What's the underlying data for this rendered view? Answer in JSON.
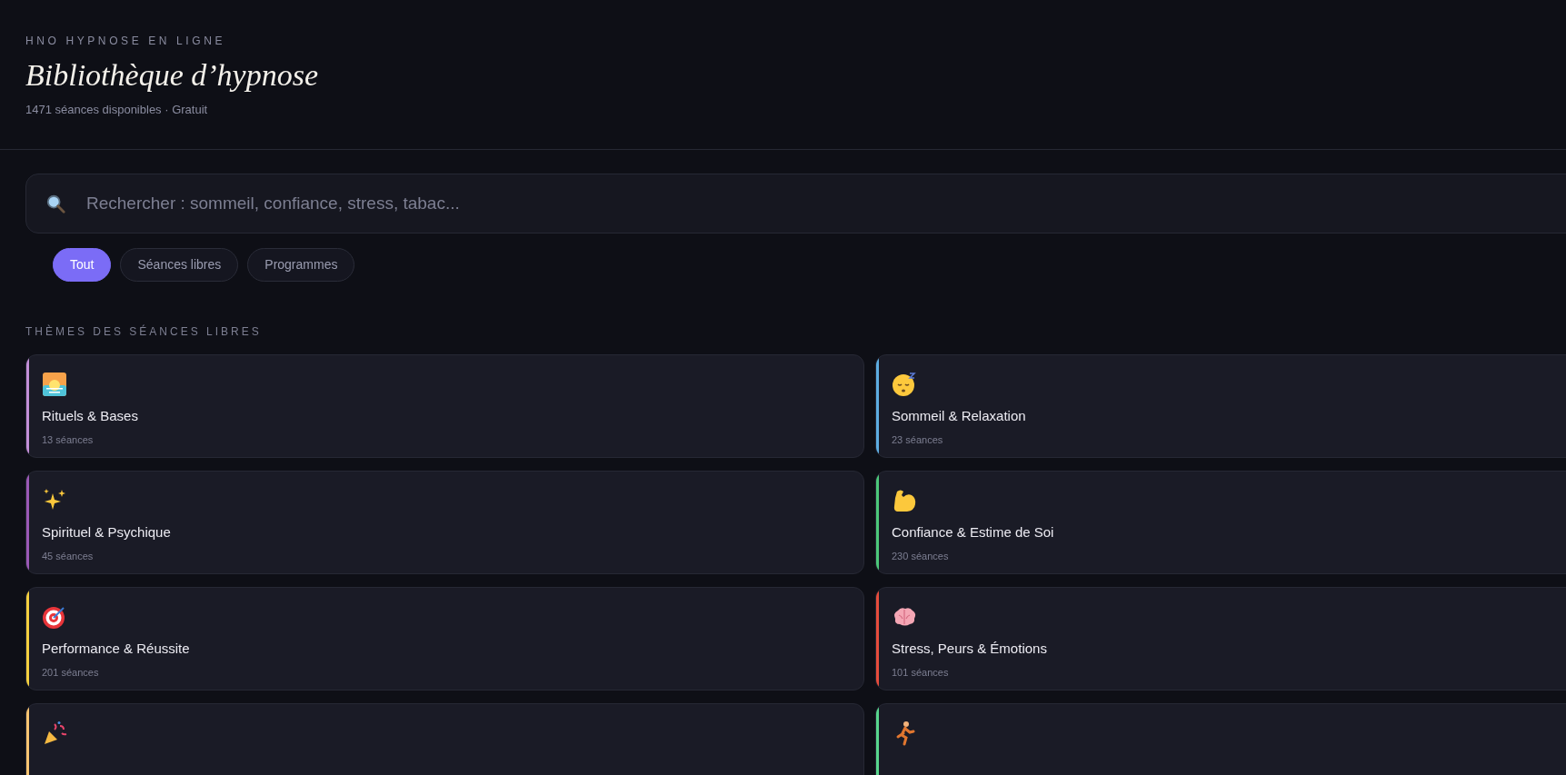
{
  "header": {
    "eyebrow": "HNO HYPNOSE EN LIGNE",
    "title": "Bibliothèque d’hypnose",
    "subtitle": "1471 séances disponibles · Gratuit"
  },
  "search": {
    "placeholder": "Rechercher : sommeil, confiance, stress, tabac..."
  },
  "filters": [
    {
      "label": "Tout",
      "selected": true
    },
    {
      "label": "Séances libres",
      "selected": false
    },
    {
      "label": "Programmes",
      "selected": false
    }
  ],
  "section_title": "THÈMES DES SÉANCES LIBRES",
  "themes": [
    {
      "kind": "sunrise",
      "name": "Rituels & Bases",
      "count": "13 séances",
      "color": "#c38fd8"
    },
    {
      "kind": "sleepy",
      "name": "Sommeil & Relaxation",
      "count": "23 séances",
      "color": "#5dade2"
    },
    {
      "kind": "sparkles",
      "name": "Spirituel & Psychique",
      "count": "45 séances",
      "color": "#9b59b6"
    },
    {
      "kind": "biceps",
      "name": "Confiance & Estime de Soi",
      "count": "230 séances",
      "color": "#4cc87a"
    },
    {
      "kind": "target",
      "name": "Performance & Réussite",
      "count": "201 séances",
      "color": "#f4d03f"
    },
    {
      "kind": "brain",
      "name": "Stress, Peurs & Émotions",
      "count": "101 séances",
      "color": "#e74c3c"
    },
    {
      "kind": "party",
      "color": "#f8c471"
    },
    {
      "kind": "runner",
      "color": "#58d68d"
    }
  ]
}
